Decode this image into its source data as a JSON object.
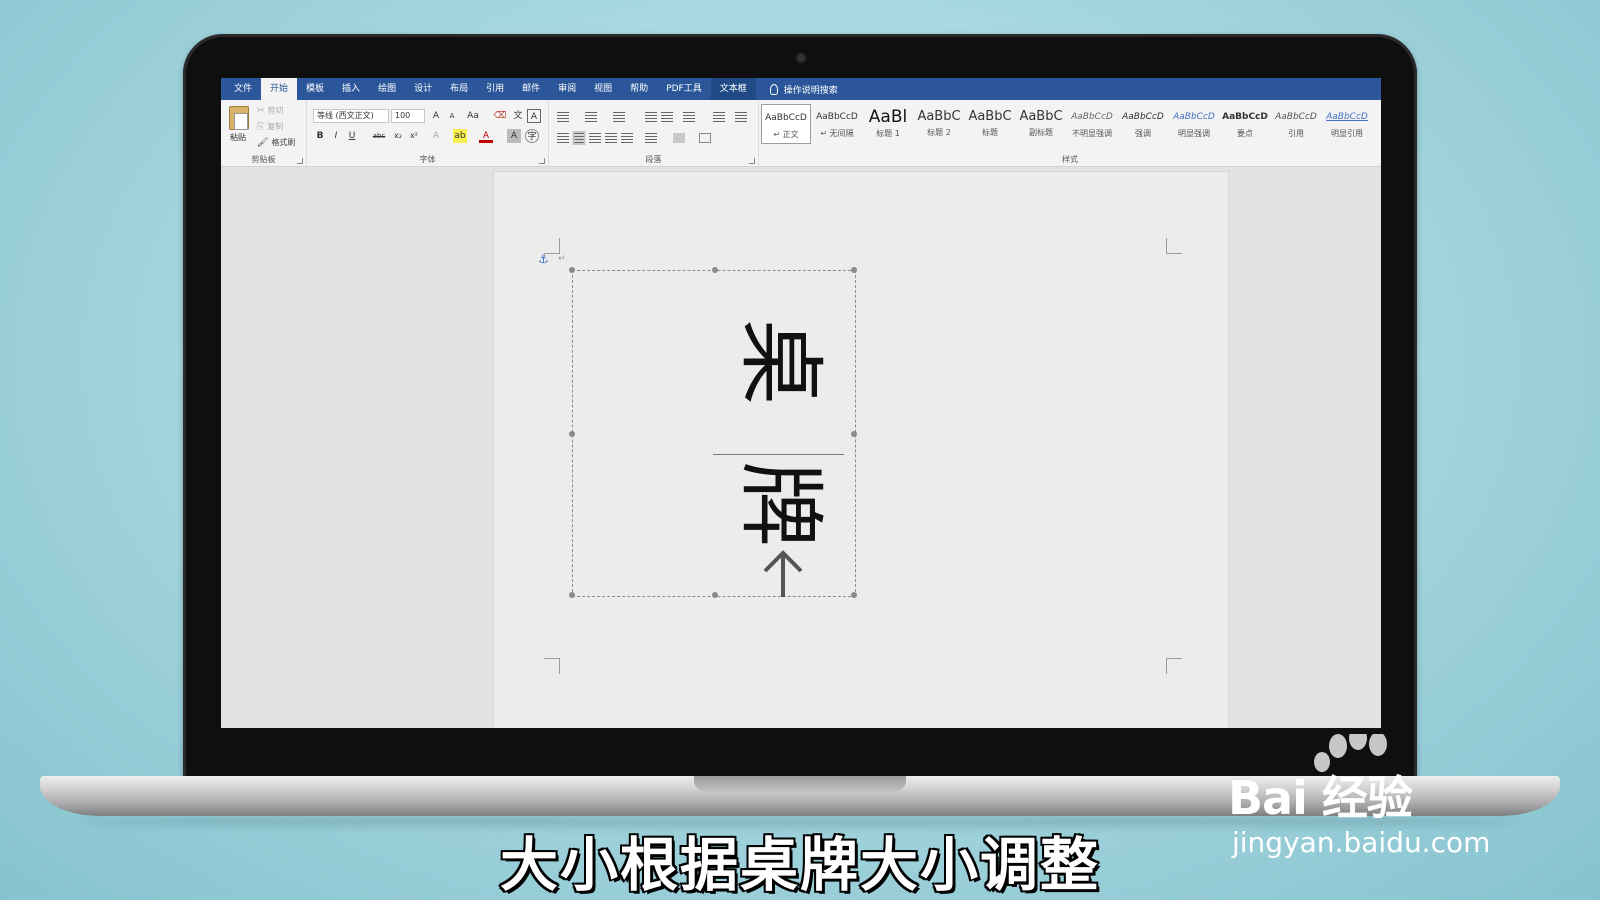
{
  "ribbon_tabs": [
    "文件",
    "开始",
    "模板",
    "插入",
    "绘图",
    "设计",
    "布局",
    "引用",
    "邮件",
    "审阅",
    "视图",
    "帮助",
    "PDF工具",
    "文本框"
  ],
  "tell_me": "操作说明搜索",
  "clipboard": {
    "paste": "粘贴",
    "cut": "剪切",
    "copy": "复制",
    "format_painter": "格式刷",
    "label": "剪贴板"
  },
  "font": {
    "name": "等线 (西文正文)",
    "size": "100",
    "label": "字体"
  },
  "paragraph": {
    "label": "段落"
  },
  "styles": {
    "label": "样式",
    "items": [
      {
        "sample": "AaBbCcD",
        "name": "↵ 正文"
      },
      {
        "sample": "AaBbCcD",
        "name": "↵ 无间隔"
      },
      {
        "sample": "AaBl",
        "name": "标题 1"
      },
      {
        "sample": "AaBbC",
        "name": "标题 2"
      },
      {
        "sample": "AaBbC",
        "name": "标题"
      },
      {
        "sample": "AaBbC",
        "name": "副标题"
      },
      {
        "sample": "AaBbCcD",
        "name": "不明显强调"
      },
      {
        "sample": "AaBbCcD",
        "name": "强调"
      },
      {
        "sample": "AaBbCcD",
        "name": "明显强调"
      },
      {
        "sample": "AaBbCcD",
        "name": "要点"
      },
      {
        "sample": "AaBbCcD",
        "name": "引用"
      },
      {
        "sample": "AaBbCcD",
        "name": "明显引用"
      }
    ]
  },
  "document": {
    "char_1": "桌",
    "char_2": "牌"
  },
  "caption": "大小根据桌牌大小调整",
  "watermark": {
    "brand": "Bai 经验",
    "url": "jingyan.baidu.com"
  },
  "colors": {
    "accent": "#2b579a",
    "ribbon": "#f3f3f3"
  }
}
